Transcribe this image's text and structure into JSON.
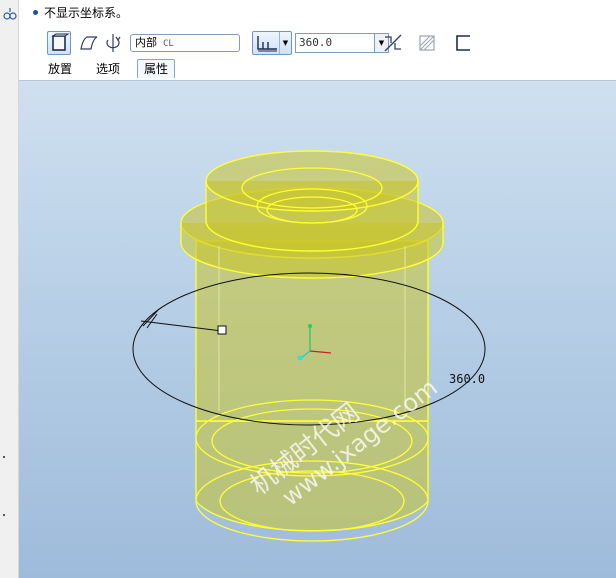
{
  "message": {
    "text": "不显示坐标系。"
  },
  "toolbar": {
    "axis_select": {
      "value": "内部",
      "axis_name": "CL"
    },
    "angle": {
      "value": "360.0"
    },
    "icons": {
      "solid": "solid-icon",
      "surface": "surface-icon",
      "revolve_direction": "revolve-direction-icon",
      "angle_type": "angle-variable-icon",
      "flip": "flip-direction-icon",
      "remove_material": "remove-material-icon",
      "thicken": "thicken-sketch-icon"
    }
  },
  "tabs": [
    {
      "label": "放置"
    },
    {
      "label": "选项"
    },
    {
      "label": "属性",
      "active": true
    }
  ],
  "graphics": {
    "dimension_value": "360.0",
    "watermark": {
      "cn": "机械时代网",
      "url": "www.jxage.com"
    },
    "colors": {
      "model_fill": "#c9c42a",
      "model_edge": "#ffff33",
      "background_top": "#cfe0f0",
      "background_bottom": "#9fbbdb"
    }
  }
}
